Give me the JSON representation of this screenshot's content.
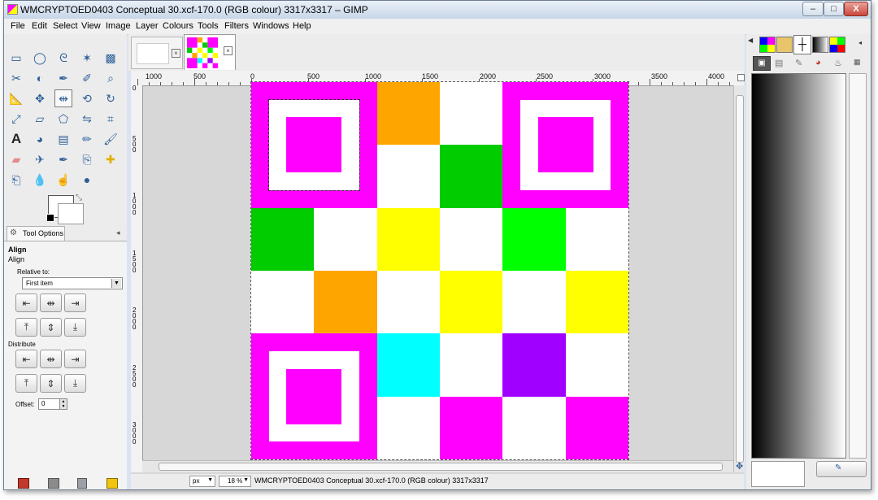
{
  "window": {
    "title": "WMCRYPTOED0403 Conceptual 30.xcf-170.0 (RGB colour) 3317x3317 – GIMP",
    "controls": [
      "–",
      "□",
      "X"
    ]
  },
  "menu": [
    "File",
    "Edit",
    "Select",
    "View",
    "Image",
    "Layer",
    "Colours",
    "Tools",
    "Filters",
    "Windows",
    "Help"
  ],
  "toolbox": {
    "tools": [
      "rect-select",
      "ellipse-select",
      "free-select",
      "fuzzy-select",
      "by-color-select",
      "scissors",
      "foreground-select",
      "paths",
      "color-picker",
      "zoom",
      "measure",
      "move",
      "align",
      "transform",
      "rotate",
      "scale",
      "shear",
      "perspective",
      "flip",
      "cage",
      "text",
      "bucket-fill",
      "blend",
      "pencil",
      "paintbrush",
      "eraser",
      "airbrush",
      "ink",
      "clone",
      "heal",
      "perspective-clone",
      "blur",
      "smudge",
      "dodge-burn"
    ],
    "selected": "align"
  },
  "tool_options": {
    "tab_label": "Tool Options",
    "heading": "Align",
    "subheading": "Align",
    "relative_to_label": "Relative to:",
    "relative_to_value": "First item",
    "distribute_label": "Distribute",
    "offset_label": "Offset:",
    "offset_value": "0"
  },
  "ruler": {
    "labels": [
      "1000",
      "500",
      "0",
      "500",
      "1000",
      "1500",
      "2000",
      "2500",
      "3000",
      "3500",
      "4000"
    ],
    "vlabels": [
      "0",
      "500",
      "1000",
      "1500",
      "2000",
      "2500",
      "3000"
    ]
  },
  "statusbar": {
    "unit": "px",
    "zoom": "18 %",
    "info": "WMCRYPTOED0403 Conceptual 30.xcf-170.0 (RGB colour) 3317x3317"
  },
  "canvas": {
    "cols": 6,
    "rows": 6,
    "cells": [
      "finder",
      "finder",
      "#ffa500",
      "#ffffff",
      "finder",
      "finder",
      "finder",
      "finder",
      "#ffffff",
      "#00cc00",
      "finder",
      "finder",
      "#00cc00",
      "#ffffff",
      "#ffff00",
      "#ffffff",
      "#00ff00",
      "#ffffff",
      "#ffffff",
      "#ffa500",
      "#ffffff",
      "#ffff00",
      "#ffffff",
      "#ffff00",
      "finder",
      "finder",
      "#00ffff",
      "#ffffff",
      "#a000ff",
      "#ffffff",
      "finder",
      "finder",
      "#ffffff",
      "#ff00ff",
      "#ffffff",
      "#ff00ff"
    ],
    "finder_color": "#ff00ff"
  },
  "colors": {
    "accent": "#ff00ff",
    "panel": "#ececec",
    "canvas_bg": "#d7d7d7"
  }
}
